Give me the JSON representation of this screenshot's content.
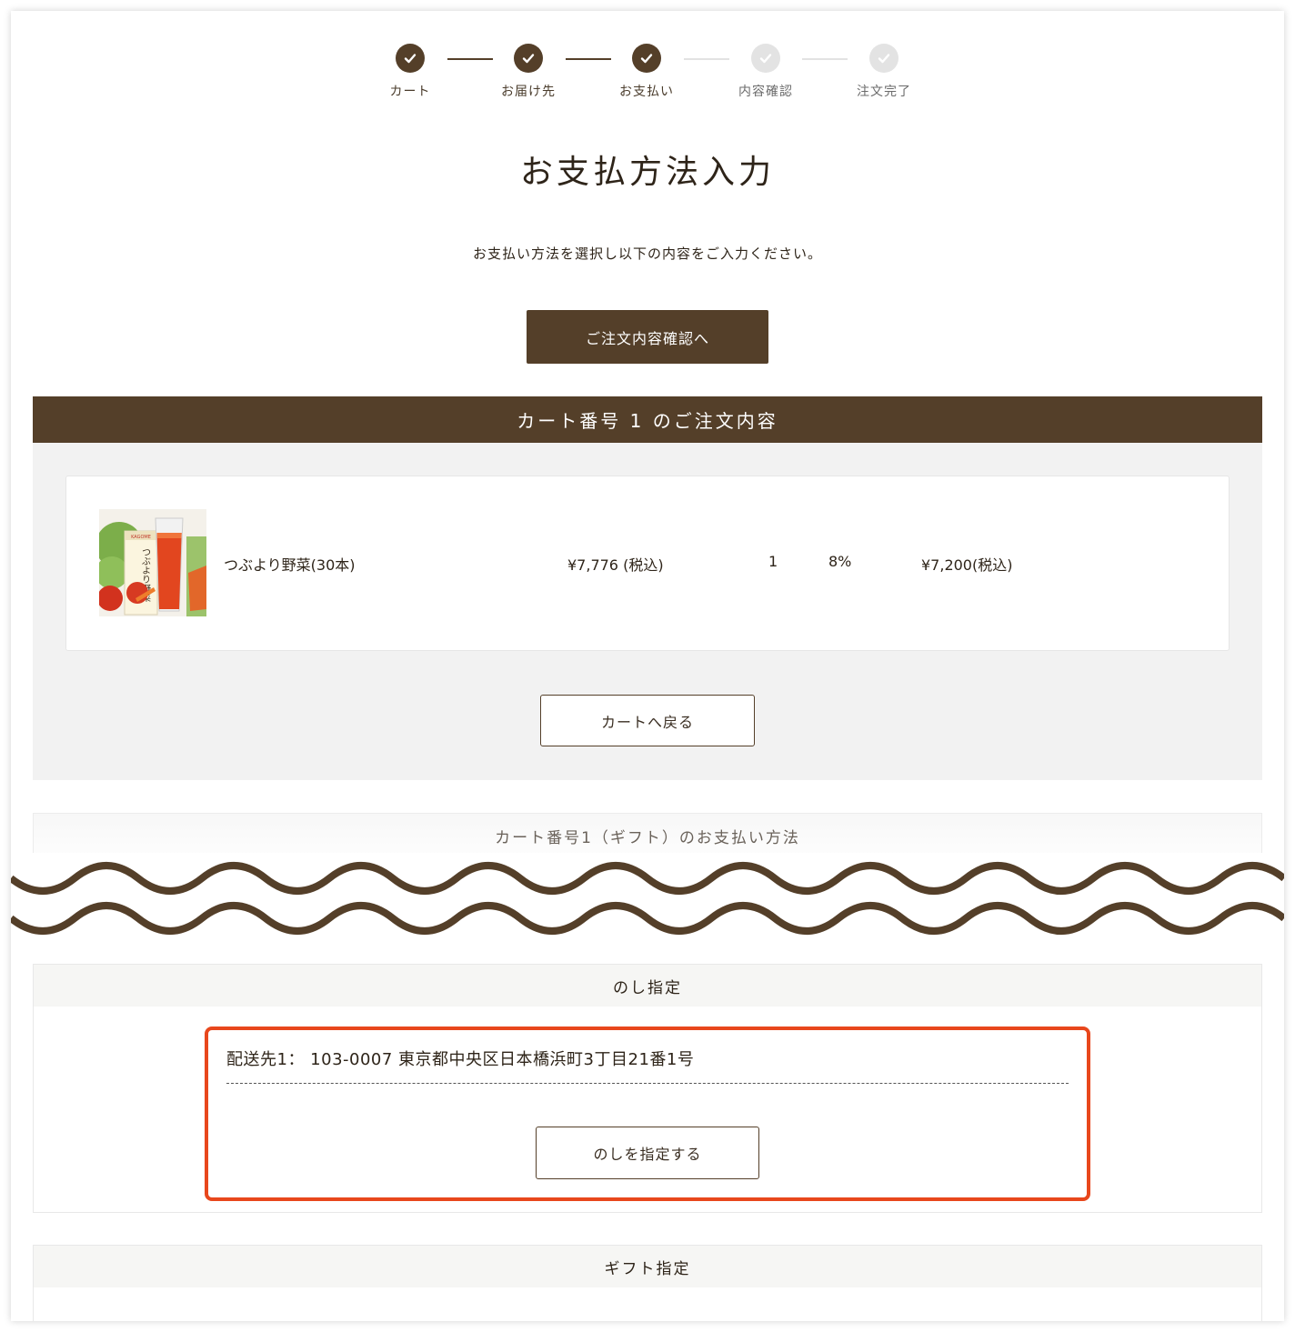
{
  "stepper": {
    "steps": [
      {
        "label": "カート",
        "done": true
      },
      {
        "label": "お届け先",
        "done": true
      },
      {
        "label": "お支払い",
        "done": true
      },
      {
        "label": "内容確認",
        "done": false
      },
      {
        "label": "注文完了",
        "done": false
      }
    ]
  },
  "page": {
    "title": "お支払方法入力",
    "lead": "お支払い方法を選択し以下の内容をご入力ください。",
    "confirm_button": "ご注文内容確認へ"
  },
  "cart": {
    "header": "カート番号 1 のご注文内容",
    "item": {
      "name": "つぶより野菜(30本)",
      "price": "¥7,776 (税込)",
      "quantity": "1",
      "tax_rate": "8%",
      "subtotal": "¥7,200(税込)",
      "package_brand": "KAGOME",
      "package_text": "つぶより野菜"
    },
    "back_button": "カートへ戻る"
  },
  "payment": {
    "title": "カート番号1（ギフト）のお支払い方法"
  },
  "noshi": {
    "title": "のし指定",
    "address": "配送先1： 103-0007 東京都中央区日本橋浜町3丁目21番1号",
    "button": "のしを指定する"
  },
  "gift": {
    "title": "ギフト指定"
  },
  "colors": {
    "brand_brown": "#543f29",
    "highlight_red": "#e8471c",
    "panel_gray": "#f2f2f2"
  }
}
